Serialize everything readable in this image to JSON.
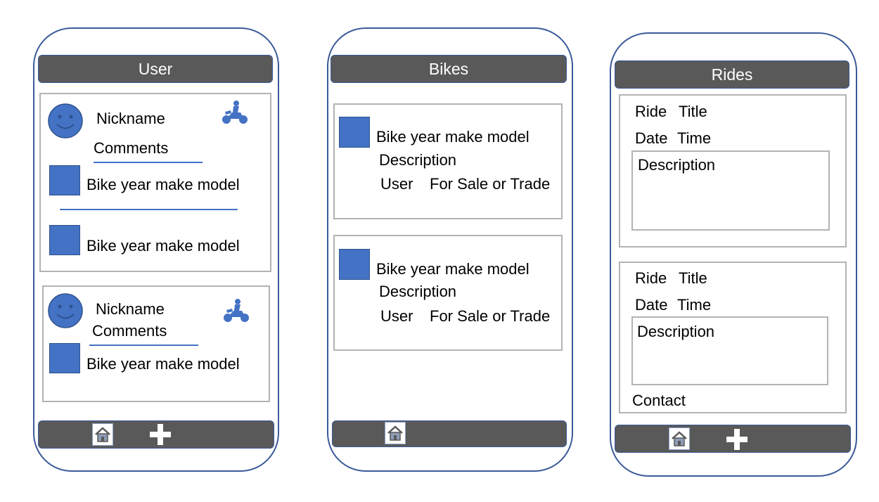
{
  "screens": {
    "user": {
      "title": "User",
      "posts": [
        {
          "nickname": "Nickname",
          "comments": "Comments",
          "bikes": [
            "Bike year make model",
            "Bike year make model"
          ]
        },
        {
          "nickname": "Nickname",
          "comments": "Comments",
          "bikes": [
            "Bike year make model"
          ]
        }
      ],
      "icons": {
        "avatar": "smiley-face-icon",
        "rider": "motorcycle-rider-icon",
        "thumb": "bike-thumbnail",
        "home": "home-icon",
        "add": "plus-icon"
      }
    },
    "bikes": {
      "title": "Bikes",
      "listings": [
        {
          "bike": "Bike year make model",
          "description": "Description",
          "user": "User",
          "status": "For Sale or Trade"
        },
        {
          "bike": "Bike year make model",
          "description": "Description",
          "user": "User",
          "status": "For Sale or Trade"
        }
      ],
      "icons": {
        "home": "home-icon"
      }
    },
    "rides": {
      "title": "Rides",
      "rides": [
        {
          "ride": "Ride",
          "title": "Title",
          "date": "Date",
          "time": "Time",
          "description": "Description"
        },
        {
          "ride": "Ride",
          "title": "Title",
          "date": "Date",
          "time": "Time",
          "description": "Description",
          "contact": "Contact"
        }
      ],
      "icons": {
        "home": "home-icon",
        "add": "plus-icon"
      }
    }
  },
  "colors": {
    "accent": "#4472c4",
    "header": "#595959",
    "frame": "#3a5a9a",
    "card_border": "#b3b3b3"
  }
}
